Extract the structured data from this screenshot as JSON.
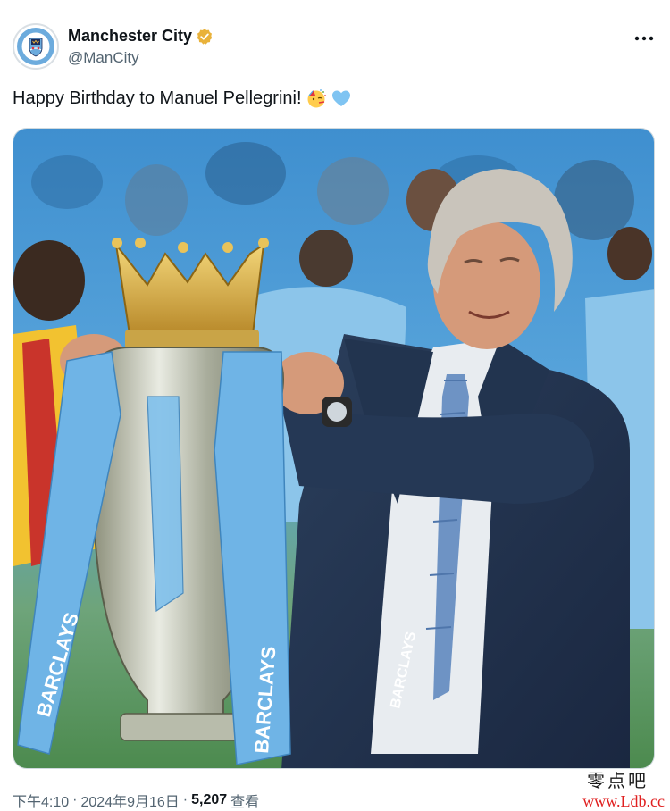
{
  "tweet": {
    "author": {
      "display_name": "Manchester City",
      "handle": "@ManCity",
      "verified": true,
      "verified_badge_color": "#e9b23a",
      "avatar_icon": "man-city-crest-icon",
      "avatar_crest_text": "MANCHESTER CITY"
    },
    "more_icon": "more-dots-icon",
    "text": "Happy Birthday to Manuel Pellegrini!",
    "emojis": [
      "party-face-icon",
      "light-blue-heart-icon"
    ],
    "media": {
      "alt": "Manuel Pellegrini holding the Premier League trophy",
      "trophy_ribbon_text": "BARCLAYS"
    },
    "footer": {
      "time": "下午4:10",
      "separator": "·",
      "date": "2024年9月16日",
      "views_count": "5,207",
      "views_label": "查看"
    }
  },
  "watermark": {
    "site_name": "零点吧",
    "url": "www.Ldb.cc"
  },
  "colors": {
    "text_primary": "#0f1419",
    "text_secondary": "#536471",
    "city_blue": "#6cabdd"
  }
}
